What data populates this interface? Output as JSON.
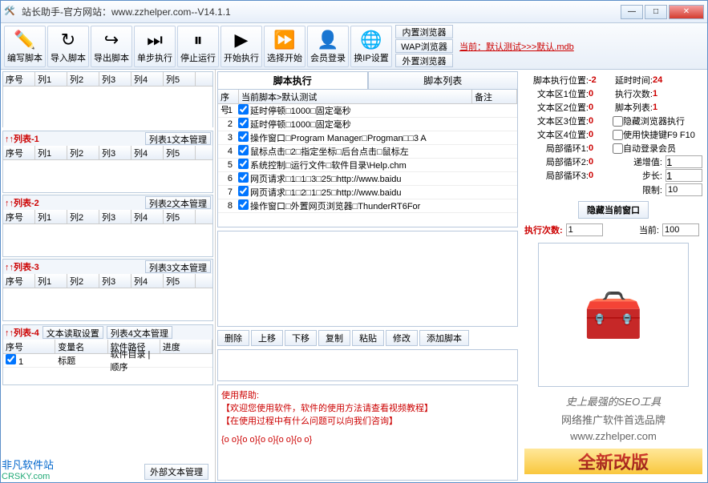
{
  "title": "站长助手-官方网站：www.zzhelper.com--V14.1.1",
  "toolbar": [
    {
      "icon": "✏️",
      "label": "编写脚本"
    },
    {
      "icon": "↻",
      "label": "导入脚本"
    },
    {
      "icon": "↪",
      "label": "导出脚本"
    },
    {
      "icon": "⏭",
      "label": "单步执行"
    },
    {
      "icon": "⏸",
      "label": "停止运行"
    },
    {
      "icon": "▶",
      "label": "开始执行"
    },
    {
      "icon": "⏩",
      "label": "选择开始"
    },
    {
      "icon": "👤",
      "label": "会员登录"
    },
    {
      "icon": "🌐",
      "label": "换IP设置"
    }
  ],
  "browser_buttons": [
    "内置浏览器",
    "WAP浏览器",
    "外置浏览器"
  ],
  "db_link": "当前：默认测试>>>默认.mdb",
  "left_top_cols": [
    "序号",
    "列1",
    "列2",
    "列3",
    "列4",
    "列5"
  ],
  "lists": [
    {
      "label": "↑↑列表-1",
      "btn": "列表1文本管理",
      "cols": [
        "序号",
        "列1",
        "列2",
        "列3",
        "列4",
        "列5"
      ]
    },
    {
      "label": "↑↑列表-2",
      "btn": "列表2文本管理",
      "cols": [
        "序号",
        "列1",
        "列2",
        "列3",
        "列4",
        "列5"
      ]
    },
    {
      "label": "↑↑列表-3",
      "btn": "列表3文本管理",
      "cols": [
        "序号",
        "列1",
        "列2",
        "列3",
        "列4",
        "列5"
      ]
    }
  ],
  "list4": {
    "label": "↑↑列表-4",
    "btn1": "文本读取设置",
    "btn2": "列表4文本管理",
    "cols": [
      "序号",
      "变量名",
      "软件路径",
      "进度"
    ],
    "row": [
      "1",
      "标题",
      "软件目录 | 顺序",
      ""
    ]
  },
  "tabs": [
    "脚本执行",
    "脚本列表"
  ],
  "script_cols": [
    "序号",
    "当前脚本>默认测试",
    "备注"
  ],
  "scripts": [
    "延时停顿□1000□固定毫秒",
    "延时停顿□1000□固定毫秒",
    "操作窗口□Program Manager□Progman□□3 A",
    "鼠标点击□2□指定坐标□后台点击□鼠标左",
    "系统控制□运行文件□软件目录\\Help.chm",
    "网页请求□1□1□3□25□http://www.baidu",
    "网页请求□1□2□1□25□http://www.baidu",
    "操作窗口□外置网页浏览器□ThunderRT6For"
  ],
  "actions": [
    "删除",
    "上移",
    "下移",
    "复制",
    "粘贴",
    "修改",
    "添加脚本"
  ],
  "help": {
    "title": "使用帮助:",
    "l1": "【欢迎您使用软件，软件的使用方法请查看视频教程】",
    "l2": "【在使用过程中有什么问题可以向我们咨询】",
    "dots": "{o o}{o o}{o o}{o o}{o o}"
  },
  "info": [
    {
      "k": "脚本执行位置:",
      "v": "-2",
      "k2": "延时时间:",
      "v2": "24"
    },
    {
      "k": "文本区1位置:",
      "v": "0",
      "k2": "执行次数:",
      "v2": "1"
    },
    {
      "k": "文本区2位置:",
      "v": "0",
      "k2": "脚本列表:",
      "v2": "1"
    },
    {
      "k": "文本区3位置:",
      "v": "0",
      "chk": "隐藏浏览器执行"
    },
    {
      "k": "文本区4位置:",
      "v": "0",
      "chk": "使用快捷键F9 F10"
    },
    {
      "k": "局部循环1:",
      "v": "0",
      "chk": "自动登录会员"
    },
    {
      "k": "局部循环2:",
      "v": "0"
    },
    {
      "k": "局部循环3:",
      "v": "0"
    }
  ],
  "params": [
    {
      "lbl": "递增值:",
      "val": "1"
    },
    {
      "lbl": "步长:",
      "val": "1"
    },
    {
      "lbl": "限制:",
      "val": "10"
    }
  ],
  "hide_btn": "隐藏当前窗口",
  "exec": {
    "lbl": "执行次数:",
    "v1": "1",
    "lbl2": "当前:",
    "v2": "100"
  },
  "promo1": "史上最强的SEO工具",
  "promo2": "网络推广软件首选品牌",
  "promo3": "www.zzhelper.com",
  "banner": "全新改版",
  "ext_btn": "外部文本管理",
  "watermark": {
    "cn": "非凡软件站",
    "en": "CRSKY.com"
  }
}
